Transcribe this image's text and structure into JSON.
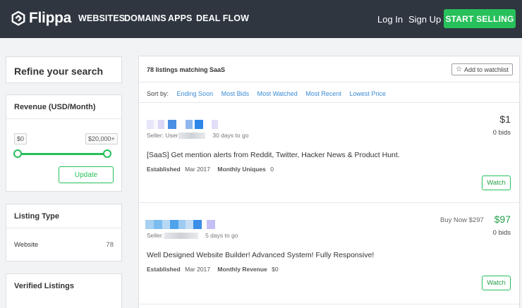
{
  "nav": {
    "logo_text": "Flippa",
    "links": [
      "WEBSITES",
      "DOMAINS",
      "APPS",
      "DEAL FLOW"
    ],
    "login": "Log In",
    "signup": "Sign Up",
    "cta": "START SELLING"
  },
  "sidebar": {
    "refine_title": "Refine your search",
    "revenue": {
      "title": "Revenue (USD/Month)",
      "min_label": "$0",
      "max_label": "$20,000+",
      "update_label": "Update"
    },
    "listing_type": {
      "title": "Listing Type",
      "item_label": "Website",
      "item_count": "78"
    },
    "verified_title": "Verified Listings"
  },
  "main": {
    "results_count": "78 listings matching SaaS",
    "watchlist_label": "Add to watchlist",
    "sort": {
      "label": "Sort by:",
      "options": [
        "Ending Soon",
        "Most Bids",
        "Most Watched",
        "Most Recent",
        "Lowest Price"
      ]
    },
    "listings": [
      {
        "seller_label": "Seller: User",
        "time_left": "30 days to go",
        "description": "[SaaS] Get mention alerts from Reddit, Twitter, Hacker News & Product Hunt.",
        "established_label": "Established",
        "established_value": "Mar 2017",
        "metric_label": "Monthly Uniques",
        "metric_value": "0",
        "price": "$1",
        "bids": "0 bids",
        "watch_label": "Watch"
      },
      {
        "seller_label": "Seller:",
        "time_left": "5 days to go",
        "description": "Well Designed Website Builder! Advanced System! Fully Responsive!",
        "established_label": "Established",
        "established_value": "Mar 2017",
        "metric_label": "Monthly Revenue",
        "metric_value": "$0",
        "buy_now": "Buy Now  $297",
        "price": "$97",
        "bids": "0 bids",
        "watch_label": "Watch"
      }
    ]
  },
  "colors": {
    "nav_bg": "#2f3640",
    "accent_green": "#27c05a",
    "link_blue": "#3b8bd4"
  }
}
